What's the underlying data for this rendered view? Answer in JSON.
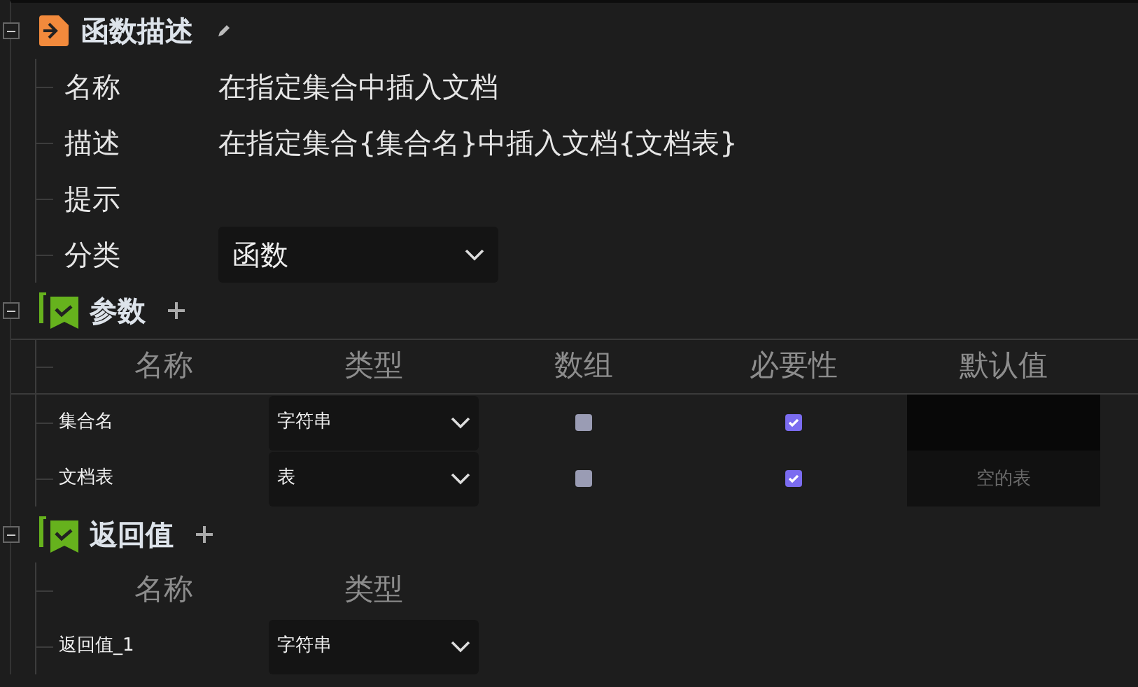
{
  "description": {
    "title": "函数描述",
    "expanded": true,
    "fields": [
      {
        "kind": "text",
        "label": "名称",
        "value": "在指定集合中插入文档"
      },
      {
        "kind": "text",
        "label": "描述",
        "value": "在指定集合{集合名}中插入文档{文档表}"
      },
      {
        "kind": "text",
        "label": "提示"
      },
      {
        "kind": "select",
        "label": "分类",
        "value": "函数"
      }
    ]
  },
  "parameters": {
    "title": "参数",
    "expanded": true,
    "columns": [
      "名称",
      "类型",
      "数组",
      "必要性",
      "默认值"
    ],
    "rows": [
      {
        "name": "集合名",
        "type": "字符串",
        "array": false,
        "required": true,
        "default": {
          "focused": true
        }
      },
      {
        "name": "文档表",
        "type": "表",
        "array": false,
        "required": true,
        "default": {
          "focused": false,
          "placeholder": "空的表"
        }
      }
    ]
  },
  "return_value": {
    "title": "返回值",
    "expanded": true,
    "columns": [
      "名称",
      "类型"
    ],
    "rows": [
      {
        "name": "返回值_1",
        "type": "字符串"
      }
    ]
  }
}
